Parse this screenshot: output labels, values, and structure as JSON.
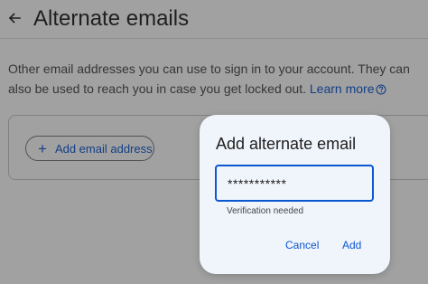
{
  "header": {
    "title": "Alternate emails",
    "back_icon": "arrow-left-icon"
  },
  "main": {
    "description": "Other email addresses you can use to sign in to your account. They can also be used to reach you in case you get locked out.",
    "learn_more": "Learn more",
    "help_icon": "question-circle-icon",
    "add_button_label": "Add email address",
    "add_button_icon": "plus-icon"
  },
  "dialog": {
    "title": "Add alternate email",
    "input_value": "***********",
    "helper_text": "Verification needed",
    "cancel_label": "Cancel",
    "add_label": "Add"
  },
  "colors": {
    "accent": "#0b57d0",
    "scrim": "#1f1f1f",
    "dialog_bg": "#f0f4fb"
  }
}
